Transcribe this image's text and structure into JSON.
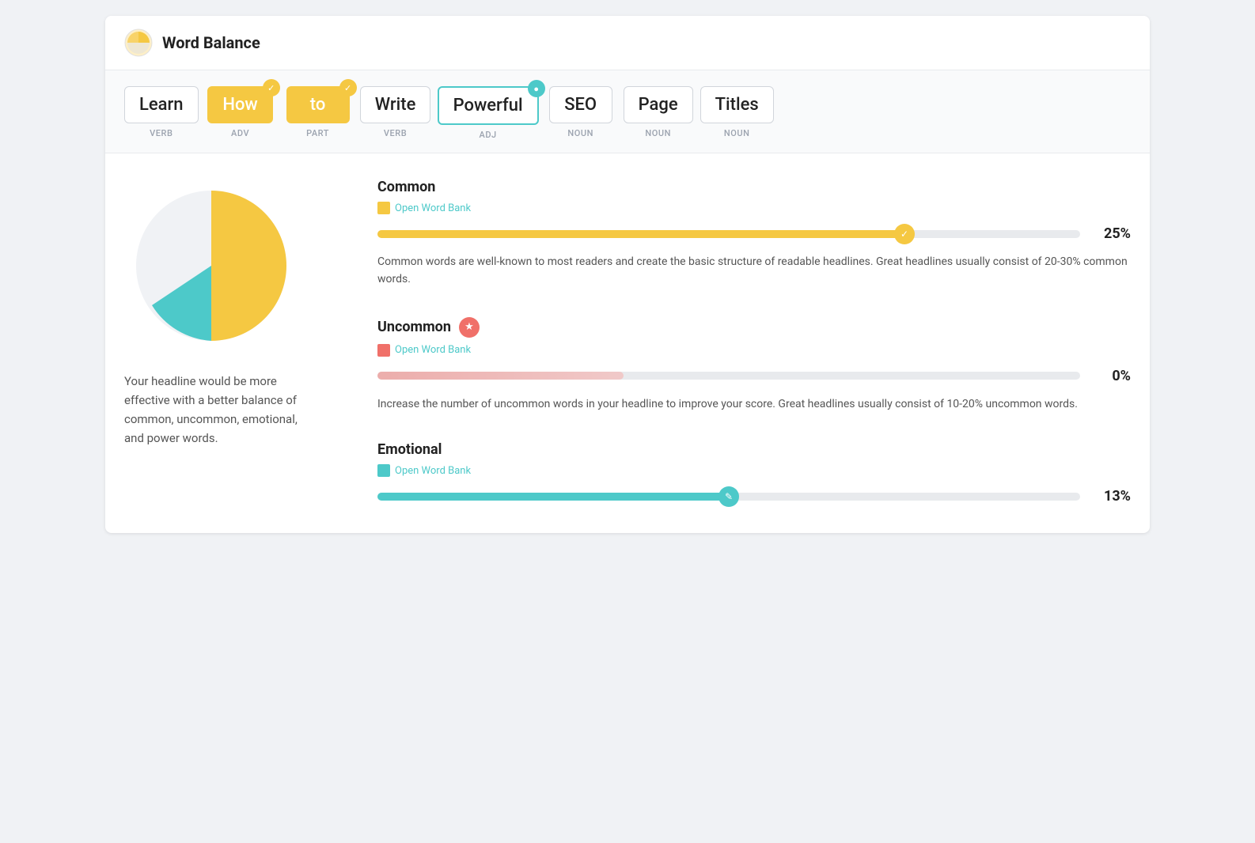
{
  "header": {
    "title": "Word Balance"
  },
  "words": [
    {
      "text": "Learn",
      "pos": "VERB",
      "style": "plain"
    },
    {
      "text": "How",
      "pos": "ADV",
      "style": "yellow",
      "badge": "check"
    },
    {
      "text": "to",
      "pos": "PART",
      "style": "yellow",
      "badge": "check"
    },
    {
      "text": "Write",
      "pos": "VERB",
      "style": "plain"
    },
    {
      "text": "Powerful",
      "pos": "ADJ",
      "style": "teal",
      "badge": "dot"
    },
    {
      "text": "SEO",
      "pos": "NOUN",
      "style": "plain"
    },
    {
      "text": "Page",
      "pos": "NOUN",
      "style": "plain"
    },
    {
      "text": "Titles",
      "pos": "NOUN",
      "style": "plain"
    }
  ],
  "left_text": "Your headline would be more effective with a better balance of common, uncommon, emotional, and power words.",
  "metrics": [
    {
      "id": "common",
      "title": "Common",
      "icon_type": "check",
      "icon_color": "yellow",
      "bank_label": "Open Word Bank",
      "bar_color": "yellow",
      "bar_width": "75%",
      "percent": "25%",
      "description": "Common words are well-known to most readers and create the basic structure of readable headlines. Great headlines usually consist of 20-30% common words."
    },
    {
      "id": "uncommon",
      "title": "Uncommon",
      "icon_type": "star",
      "icon_color": "coral",
      "bank_label": "Open Word Bank",
      "bar_color": "coral",
      "bar_width": "0%",
      "percent": "0%",
      "description": "Increase the number of uncommon words in your headline to improve your score. Great headlines usually consist of 10-20% uncommon words."
    },
    {
      "id": "emotional",
      "title": "Emotional",
      "icon_type": "pencil",
      "icon_color": "teal",
      "bank_label": "Open Word Bank",
      "bar_color": "teal",
      "bar_width": "50%",
      "percent": "13%",
      "description": ""
    }
  ]
}
